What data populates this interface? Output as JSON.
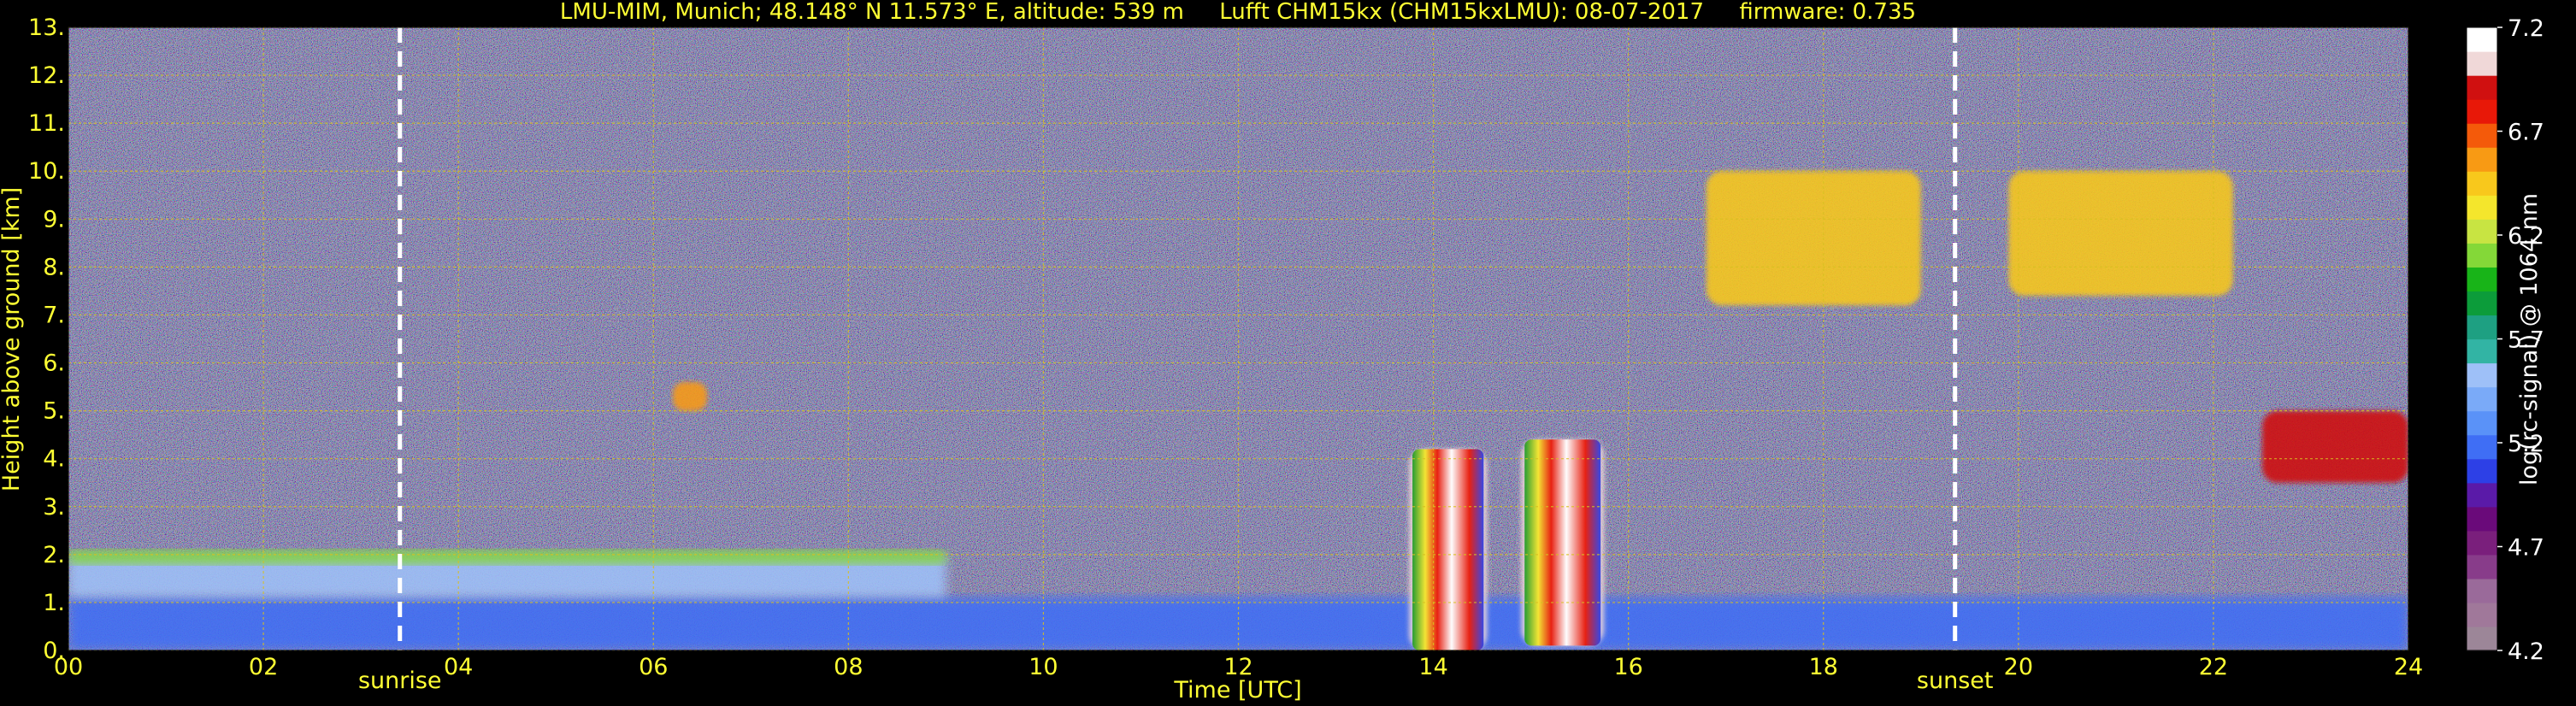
{
  "chart_data": {
    "type": "heatmap",
    "title": "LMU-MIM, Munich; 48.148° N 11.573° E, altitude: 539 m     Lufft CHM15kx (CHM15kxLMU): 08-07-2017     firmware: 0.735",
    "xlabel": "Time [UTC]",
    "ylabel": "Height above ground [km]",
    "xlim": [
      0,
      24
    ],
    "ylim": [
      0,
      13
    ],
    "x_ticks": [
      "00",
      "02",
      "04",
      "06",
      "08",
      "10",
      "12",
      "14",
      "16",
      "18",
      "20",
      "22",
      "24"
    ],
    "y_ticks": [
      "0.",
      "1.",
      "2.",
      "3.",
      "4.",
      "5.",
      "6.",
      "7.",
      "8.",
      "9.",
      "10.",
      "11.",
      "12.",
      "13."
    ],
    "grid": true,
    "annotations": [
      {
        "label": "sunrise",
        "time": 3.4
      },
      {
        "label": "sunset",
        "time": 19.35
      }
    ],
    "colorbar": {
      "label": "log(rc-signal) @ 1064 nm",
      "range": [
        4.2,
        7.2
      ],
      "ticks": [
        "7.2",
        "6.7",
        "6.2",
        "5.7",
        "5.2",
        "4.7",
        "4.2"
      ],
      "colors": [
        "#9c8698",
        "#a0789a",
        "#9a6a9a",
        "#883c8a",
        "#7a1f7c",
        "#6a0a7a",
        "#5a1aa8",
        "#2d40e6",
        "#3f6ef5",
        "#5a92f8",
        "#7aaaf8",
        "#9ec0f8",
        "#32b4a4",
        "#1ea082",
        "#0c9c3a",
        "#18b418",
        "#84d838",
        "#c8e442",
        "#f4e62c",
        "#f8c81c",
        "#f89a14",
        "#f45a0a",
        "#e81808",
        "#d01010",
        "#f0d8d8",
        "#ffffff"
      ]
    },
    "layers": [
      {
        "name": "boundary-layer",
        "x": [
          0,
          24
        ],
        "y": [
          0,
          1.1
        ],
        "value": 5.2
      },
      {
        "name": "residual-layer",
        "x": [
          0,
          9
        ],
        "y": [
          1.1,
          2.0
        ],
        "value": 5.5
      },
      {
        "name": "residual-layer-top",
        "x": [
          0,
          9
        ],
        "y": [
          1.8,
          2.1
        ],
        "value": 6.1
      },
      {
        "name": "cloud-14h",
        "x": [
          13.75,
          14.55
        ],
        "y": [
          0,
          4.2
        ],
        "value": 7.0
      },
      {
        "name": "cloud-15h",
        "x": [
          14.9,
          15.75
        ],
        "y": [
          0.1,
          4.4
        ],
        "value": 7.0
      },
      {
        "name": "cirrus-17-19h",
        "x": [
          16.8,
          19.0
        ],
        "y": [
          7.2,
          10.0
        ],
        "value": 6.5
      },
      {
        "name": "cirrus-20-22h",
        "x": [
          19.9,
          22.2
        ],
        "y": [
          7.4,
          10.0
        ],
        "value": 6.5
      },
      {
        "name": "cloud-6h",
        "x": [
          6.2,
          6.55
        ],
        "y": [
          5.0,
          5.6
        ],
        "value": 6.6
      },
      {
        "name": "cloud-23h",
        "x": [
          22.5,
          24
        ],
        "y": [
          3.5,
          5.0
        ],
        "value": 6.9
      }
    ]
  }
}
